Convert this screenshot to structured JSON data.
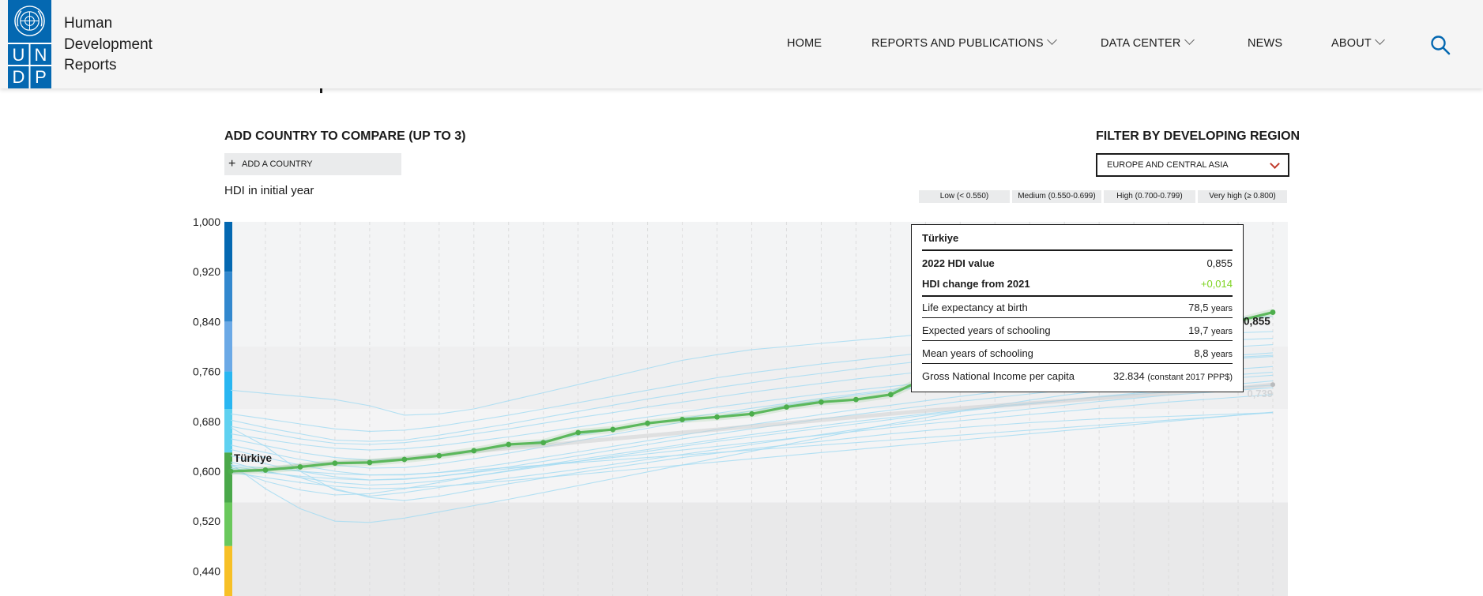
{
  "header": {
    "logo_letters": [
      "U",
      "N",
      "D",
      "P"
    ],
    "site_title_lines": [
      "Human",
      "Development",
      "Reports"
    ],
    "nav": [
      {
        "label": "HOME",
        "dropdown": false
      },
      {
        "label": "REPORTS AND PUBLICATIONS",
        "dropdown": true
      },
      {
        "label": "DATA CENTER",
        "dropdown": true
      },
      {
        "label": "NEWS",
        "dropdown": false
      },
      {
        "label": "ABOUT",
        "dropdown": true
      }
    ],
    "search_icon": "search-icon",
    "brand_color": "#0468b1"
  },
  "controls": {
    "compare_heading": "ADD COUNTRY TO COMPARE (UP TO 3)",
    "add_country_label": "ADD A COUNTRY",
    "filter_heading": "FILTER BY DEVELOPING REGION",
    "region_selected": "EUROPE AND CENTRAL ASIA",
    "hdi_initial_label": "HDI in initial year"
  },
  "legend": [
    {
      "label": "Low (< 0.550)",
      "color": "#f7c027"
    },
    {
      "label": "Medium (0.550-0.699)",
      "color": "#5cb85c"
    },
    {
      "label": "High (0.700-0.799)",
      "color": "#2bb7e8"
    },
    {
      "label": "Very high (≥ 0.800)",
      "color": "#0468b1"
    }
  ],
  "chart_data": {
    "type": "line",
    "ylim": [
      0.4,
      1.0
    ],
    "y_ticks": [
      "1,000",
      "0,920",
      "0,840",
      "0,760",
      "0,680",
      "0,600",
      "0,520",
      "0,440"
    ],
    "highlight_series": {
      "name": "Türkiye",
      "color": "#5cb85c",
      "start_label": "Türkiye",
      "end_label": "0,855",
      "values": [
        0.6,
        0.602,
        0.607,
        0.613,
        0.614,
        0.619,
        0.625,
        0.633,
        0.643,
        0.646,
        0.662,
        0.667,
        0.677,
        0.683,
        0.687,
        0.692,
        0.703,
        0.711,
        0.715,
        0.723,
        0.749,
        0.767,
        0.78,
        0.797,
        0.807,
        0.815,
        0.823,
        0.829,
        0.833,
        0.841,
        0.855
      ]
    },
    "region_average": {
      "color": "#c9cbcd",
      "end_label": "0,739",
      "values": [
        0.598,
        0.603,
        0.609,
        0.613,
        0.616,
        0.62,
        0.626,
        0.632,
        0.637,
        0.641,
        0.647,
        0.652,
        0.657,
        0.662,
        0.667,
        0.672,
        0.677,
        0.682,
        0.687,
        0.692,
        0.697,
        0.701,
        0.705,
        0.709,
        0.713,
        0.717,
        0.721,
        0.725,
        0.729,
        0.733,
        0.739
      ]
    },
    "other_series": [
      {
        "values": [
          0.73,
          0.725,
          0.72,
          0.715,
          0.705,
          0.69,
          0.692,
          0.7,
          0.713,
          0.726,
          0.739,
          0.752,
          0.765,
          0.778,
          0.787,
          0.795,
          0.8,
          0.805,
          0.81,
          0.815,
          0.82,
          0.824,
          0.828,
          0.832,
          0.835,
          0.838,
          0.84,
          0.842,
          0.845,
          0.846,
          0.848
        ]
      },
      {
        "values": [
          0.692,
          0.684,
          0.676,
          0.668,
          0.664,
          0.666,
          0.672,
          0.681,
          0.69,
          0.7,
          0.71,
          0.72,
          0.73,
          0.74,
          0.75,
          0.758,
          0.765,
          0.772,
          0.778,
          0.784,
          0.79,
          0.795,
          0.8,
          0.804,
          0.808,
          0.812,
          0.815,
          0.818,
          0.82,
          0.822,
          0.824
        ]
      },
      {
        "values": [
          0.682,
          0.67,
          0.66,
          0.65,
          0.648,
          0.65,
          0.658,
          0.667,
          0.676,
          0.686,
          0.696,
          0.706,
          0.716,
          0.725,
          0.734,
          0.742,
          0.75,
          0.757,
          0.764,
          0.771,
          0.777,
          0.782,
          0.787,
          0.792,
          0.796,
          0.8,
          0.803,
          0.806,
          0.809,
          0.811,
          0.813
        ]
      },
      {
        "values": [
          0.672,
          0.662,
          0.652,
          0.645,
          0.643,
          0.646,
          0.652,
          0.66,
          0.668,
          0.677,
          0.686,
          0.694,
          0.703,
          0.711,
          0.719,
          0.727,
          0.734,
          0.741,
          0.748,
          0.754,
          0.76,
          0.766,
          0.771,
          0.776,
          0.781,
          0.785,
          0.789,
          0.793,
          0.797,
          0.8,
          0.803
        ]
      },
      {
        "values": [
          0.66,
          0.651,
          0.643,
          0.637,
          0.634,
          0.636,
          0.641,
          0.648,
          0.655,
          0.663,
          0.671,
          0.679,
          0.687,
          0.695,
          0.703,
          0.71,
          0.717,
          0.724,
          0.73,
          0.736,
          0.742,
          0.748,
          0.754,
          0.759,
          0.764,
          0.768,
          0.772,
          0.776,
          0.78,
          0.783,
          0.786
        ]
      },
      {
        "values": [
          0.652,
          0.641,
          0.63,
          0.622,
          0.618,
          0.62,
          0.626,
          0.633,
          0.641,
          0.649,
          0.658,
          0.667,
          0.676,
          0.685,
          0.693,
          0.701,
          0.709,
          0.717,
          0.724,
          0.731,
          0.738,
          0.745,
          0.751,
          0.757,
          0.763,
          0.768,
          0.773,
          0.778,
          0.782,
          0.786,
          0.79
        ]
      },
      {
        "values": [
          0.642,
          0.63,
          0.619,
          0.61,
          0.605,
          0.606,
          0.612,
          0.62,
          0.629,
          0.639,
          0.649,
          0.659,
          0.669,
          0.679,
          0.688,
          0.697,
          0.706,
          0.714,
          0.722,
          0.729,
          0.736,
          0.743,
          0.749,
          0.755,
          0.76,
          0.765,
          0.77,
          0.774,
          0.778,
          0.781,
          0.784
        ]
      },
      {
        "values": [
          0.635,
          0.622,
          0.61,
          0.6,
          0.594,
          0.594,
          0.598,
          0.605,
          0.613,
          0.622,
          0.631,
          0.64,
          0.649,
          0.658,
          0.667,
          0.675,
          0.683,
          0.691,
          0.699,
          0.706,
          0.713,
          0.72,
          0.727,
          0.733,
          0.739,
          0.745,
          0.75,
          0.755,
          0.76,
          0.764,
          0.768
        ]
      },
      {
        "values": [
          0.625,
          0.612,
          0.6,
          0.591,
          0.586,
          0.587,
          0.592,
          0.599,
          0.607,
          0.616,
          0.625,
          0.634,
          0.643,
          0.652,
          0.66,
          0.668,
          0.676,
          0.684,
          0.691,
          0.698,
          0.705,
          0.712,
          0.718,
          0.724,
          0.73,
          0.736,
          0.741,
          0.746,
          0.751,
          0.755,
          0.759
        ]
      },
      {
        "values": [
          0.615,
          0.6,
          0.59,
          0.582,
          0.578,
          0.58,
          0.585,
          0.592,
          0.6,
          0.608,
          0.616,
          0.624,
          0.632,
          0.64,
          0.648,
          0.655,
          0.662,
          0.669,
          0.676,
          0.683,
          0.69,
          0.696,
          0.702,
          0.708,
          0.714,
          0.72,
          0.725,
          0.73,
          0.735,
          0.74,
          0.745
        ]
      },
      {
        "values": [
          0.605,
          0.598,
          0.592,
          0.588,
          0.586,
          0.588,
          0.592,
          0.598,
          0.604,
          0.61,
          0.616,
          0.622,
          0.628,
          0.634,
          0.64,
          0.646,
          0.652,
          0.658,
          0.664,
          0.67,
          0.676,
          0.681,
          0.686,
          0.691,
          0.696,
          0.701,
          0.706,
          0.711,
          0.715,
          0.719,
          0.723
        ]
      },
      {
        "values": [
          0.598,
          0.59,
          0.582,
          0.576,
          0.572,
          0.573,
          0.576,
          0.58,
          0.585,
          0.59,
          0.595,
          0.6,
          0.605,
          0.61,
          0.615,
          0.62,
          0.625,
          0.63,
          0.635,
          0.64,
          0.645,
          0.65,
          0.655,
          0.66,
          0.665,
          0.67,
          0.675,
          0.68,
          0.685,
          0.69,
          0.695
        ]
      },
      {
        "values": [
          0.608,
          0.6,
          0.59,
          0.572,
          0.558,
          0.553,
          0.56,
          0.57,
          0.58,
          0.589,
          0.598,
          0.606,
          0.614,
          0.622,
          0.629,
          0.636,
          0.642,
          0.648,
          0.654,
          0.66,
          0.665,
          0.67,
          0.674,
          0.678,
          0.681,
          0.684,
          0.686,
          0.688,
          0.69,
          0.692,
          0.694
        ]
      },
      {
        "values": [
          0.67,
          0.64,
          0.6,
          0.57,
          0.56,
          0.566,
          0.574,
          0.582,
          0.589,
          0.596,
          0.603,
          0.611,
          0.619,
          0.627,
          0.635,
          0.643,
          0.651,
          0.659,
          0.667,
          0.674,
          0.681,
          0.688,
          0.694,
          0.7,
          0.706,
          0.712,
          0.717,
          0.722,
          0.726,
          0.73,
          0.734
        ]
      },
      {
        "values": [
          0.612,
          0.572,
          0.54,
          0.52,
          0.518,
          0.525,
          0.535,
          0.545,
          0.555,
          0.566,
          0.577,
          0.588,
          0.599,
          0.61,
          0.621,
          0.632,
          0.643,
          0.654,
          0.665,
          0.676,
          0.686,
          0.696,
          0.705,
          0.714,
          0.722,
          0.729,
          0.735,
          0.741,
          0.746,
          0.75,
          0.754
        ]
      },
      {
        "values": [
          0.604,
          0.584,
          0.57,
          0.562,
          0.564,
          0.572,
          0.582,
          0.592,
          0.601,
          0.61,
          0.619,
          0.627,
          0.635,
          0.643,
          0.651,
          0.659,
          0.666,
          0.673,
          0.68,
          0.686,
          0.692,
          0.698,
          0.704,
          0.709,
          0.714,
          0.719,
          0.723,
          0.727,
          0.731,
          0.735,
          0.738
        ]
      },
      {
        "values": [
          0.61,
          0.605,
          0.6,
          0.596,
          0.594,
          0.595,
          0.598,
          0.602,
          0.606,
          0.61,
          0.614,
          0.618,
          0.622,
          0.626,
          0.63,
          0.634,
          0.638,
          0.642,
          0.646,
          0.65,
          0.654,
          0.658,
          0.662,
          0.666,
          0.67,
          0.674,
          0.678,
          0.682,
          0.686,
          0.69,
          0.694
        ]
      }
    ]
  },
  "tooltip": {
    "country": "Türkiye",
    "hdi_value_label": "2022 HDI value",
    "hdi_value": "0,855",
    "change_label": "HDI change from 2021",
    "change_value": "+0,014",
    "change_color": "#7ed321",
    "rows": [
      {
        "label": "Life expectancy at birth",
        "value": "78,5",
        "unit": "years"
      },
      {
        "label": "Expected years of schooling",
        "value": "19,7",
        "unit": "years"
      },
      {
        "label": "Mean years of schooling",
        "value": "8,8",
        "unit": "years"
      },
      {
        "label": "Gross National Income per capita",
        "value": "32.834",
        "unit": "(constant 2017 PPP$)"
      }
    ]
  }
}
